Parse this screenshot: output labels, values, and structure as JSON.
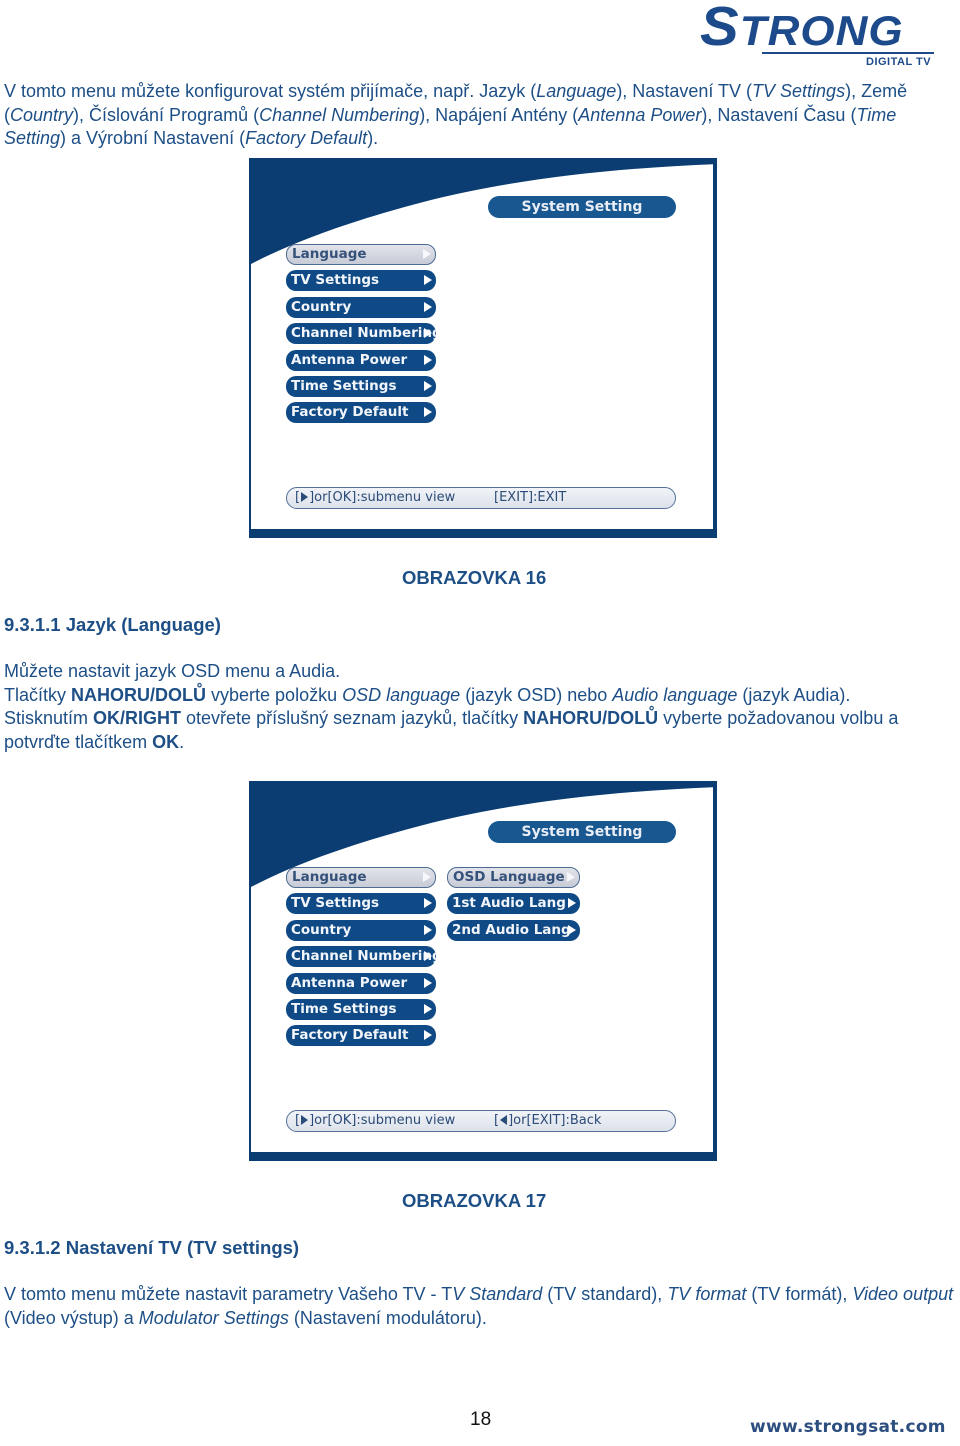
{
  "logo": {
    "brand": "STRONG",
    "subtitle": "DIGITAL TV"
  },
  "intro": {
    "parts": [
      {
        "t": "V tomto menu můžete konfigurovat systém přijímače, např. Jazyk ("
      },
      {
        "t": "Language",
        "i": true
      },
      {
        "t": "), Nastavení TV ("
      },
      {
        "t": "TV Settings",
        "i": true
      },
      {
        "t": "), Země ("
      },
      {
        "t": "Country",
        "i": true
      },
      {
        "t": "), Číslování Programů ("
      },
      {
        "t": "Channel Numbering",
        "i": true
      },
      {
        "t": "), Napájení Antény ("
      },
      {
        "t": "Antenna Power",
        "i": true
      },
      {
        "t": "), Nastavení Času ("
      },
      {
        "t": "Time Setting",
        "i": true
      },
      {
        "t": ") a Výrobní Nastavení ("
      },
      {
        "t": "Factory Default",
        "i": true
      },
      {
        "t": ")."
      }
    ]
  },
  "screen16": {
    "title": "System Setting",
    "menu": [
      {
        "label": "Language",
        "selected": true
      },
      {
        "label": "TV Settings"
      },
      {
        "label": "Country"
      },
      {
        "label": "Channel Numbering"
      },
      {
        "label": "Antenna Power"
      },
      {
        "label": "Time Settings"
      },
      {
        "label": "Factory Default"
      }
    ],
    "help_left": "or[OK]:submenu view",
    "help_right": "[EXIT]:EXIT",
    "caption": "OBRAZOVKA 16"
  },
  "section1": {
    "heading": "9.3.1.1 Jazyk (Language)",
    "parts": [
      {
        "t": "Můžete nastavit jazyk OSD menu a Audia."
      },
      {
        "br": true
      },
      {
        "t": "Tlačítky "
      },
      {
        "t": "NAHORU/DOLŮ",
        "b": true
      },
      {
        "t": " vyberte položku "
      },
      {
        "t": "OSD language",
        "i": true
      },
      {
        "t": " (jazyk OSD) nebo "
      },
      {
        "t": "Audio language",
        "i": true
      },
      {
        "t": " (jazyk Audia). Stisknutím "
      },
      {
        "t": "OK/RIGHT",
        "b": true
      },
      {
        "t": " otevřete příslušný seznam jazyků, tlačítky "
      },
      {
        "t": "NAHORU/DOLŮ",
        "b": true
      },
      {
        "t": " vyberte požadovanou volbu a potvrďte tlačítkem "
      },
      {
        "t": "OK",
        "b": true
      },
      {
        "t": "."
      }
    ]
  },
  "screen17": {
    "title": "System Setting",
    "menu": [
      {
        "label": "Language",
        "selected": true
      },
      {
        "label": "TV Settings"
      },
      {
        "label": "Country"
      },
      {
        "label": "Channel Numbering"
      },
      {
        "label": "Antenna Power"
      },
      {
        "label": "Time Settings"
      },
      {
        "label": "Factory Default"
      }
    ],
    "submenu": [
      {
        "label": "OSD Language",
        "selected": true
      },
      {
        "label": "1st Audio Lang"
      },
      {
        "label": "2nd Audio Lang"
      }
    ],
    "help_left": "or[OK]:submenu view",
    "help_right": "or[EXIT]:Back",
    "caption": "OBRAZOVKA 17"
  },
  "section2": {
    "heading": "9.3.1.2 Nastavení TV (TV settings)",
    "parts": [
      {
        "t": "V tomto menu můžete nastavit parametry Vašeho TV - T"
      },
      {
        "t": "V Standard",
        "i": true
      },
      {
        "t": " (TV standard), "
      },
      {
        "t": "TV format",
        "i": true
      },
      {
        "t": " (TV formát), "
      },
      {
        "t": "Video output",
        "i": true
      },
      {
        "t": " (Video výstup) a "
      },
      {
        "t": "Modulator Settings",
        "i": true
      },
      {
        "t": " (Nastavení modulátoru)."
      }
    ]
  },
  "footer": {
    "page_number": "18",
    "website": "www.strongsat.com"
  },
  "colors": {
    "brand_blue": "#0b3d73",
    "menu_blue": "#0f4a86",
    "text_blue": "#1d4f86"
  }
}
